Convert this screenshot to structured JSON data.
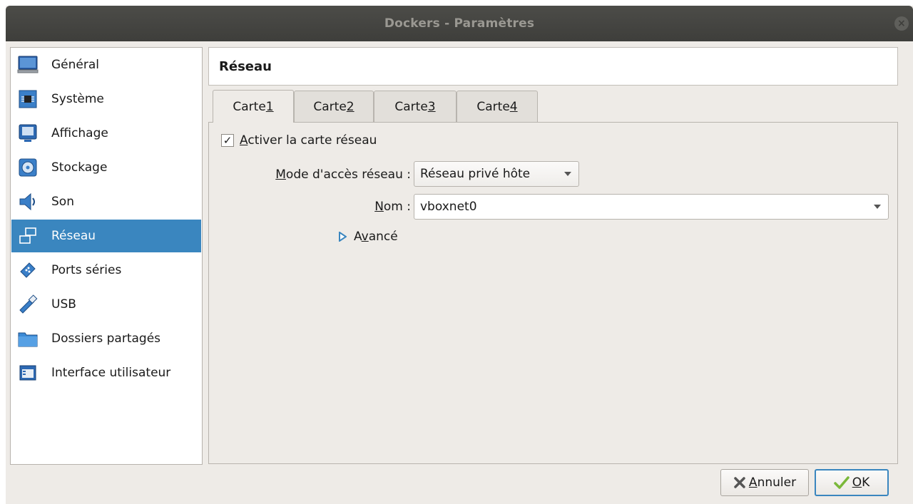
{
  "window": {
    "title": "Dockers - Paramètres"
  },
  "sidebar": {
    "items": [
      {
        "label": "Général",
        "icon": "monitor-icon"
      },
      {
        "label": "Système",
        "icon": "chip-icon"
      },
      {
        "label": "Affichage",
        "icon": "display-icon"
      },
      {
        "label": "Stockage",
        "icon": "disk-icon"
      },
      {
        "label": "Son",
        "icon": "speaker-icon"
      },
      {
        "label": "Réseau",
        "icon": "network-icon"
      },
      {
        "label": "Ports séries",
        "icon": "serial-port-icon"
      },
      {
        "label": "USB",
        "icon": "usb-icon"
      },
      {
        "label": "Dossiers partagés",
        "icon": "folder-icon"
      },
      {
        "label": "Interface utilisateur",
        "icon": "window-icon"
      }
    ],
    "selected": "Réseau"
  },
  "page": {
    "title": "Réseau"
  },
  "tabs": [
    {
      "prefix": "Carte ",
      "mnemonic": "1"
    },
    {
      "prefix": "Carte ",
      "mnemonic": "2"
    },
    {
      "prefix": "Carte ",
      "mnemonic": "3"
    },
    {
      "prefix": "Carte ",
      "mnemonic": "4"
    }
  ],
  "adapter": {
    "enable_mnemonic": "A",
    "enable_rest": "ctiver la carte réseau",
    "enabled": true,
    "mode_mnemonic": "M",
    "mode_rest": "ode d'accès réseau :",
    "mode_value": "Réseau privé hôte",
    "name_mnemonic": "N",
    "name_rest": "om :",
    "name_value": "vboxnet0",
    "advanced_pre": "A",
    "advanced_mnemonic": "v",
    "advanced_rest": "ancé"
  },
  "buttons": {
    "cancel_mnemonic": "A",
    "cancel_rest": "nnuler",
    "ok_mnemonic": "O",
    "ok_rest": "K"
  },
  "colors": {
    "selection": "#3a86bf",
    "window_bg": "#eeebe7",
    "titlebar": "#44443f"
  }
}
